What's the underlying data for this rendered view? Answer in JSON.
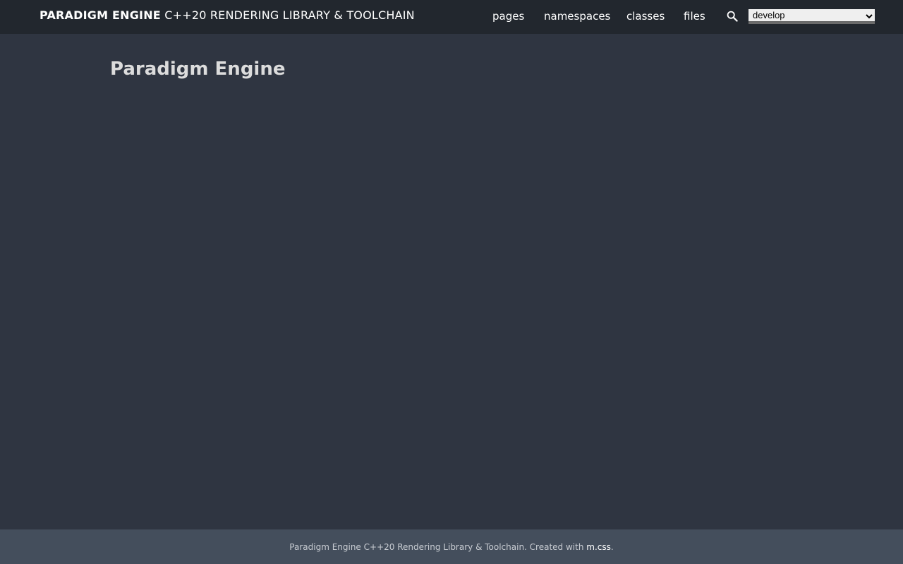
{
  "header": {
    "brand_name": "PARADIGM ENGINE",
    "brand_subtitle": "C++20 RENDERING LIBRARY & TOOLCHAIN",
    "nav": {
      "pages": "pages",
      "namespaces": "namespaces",
      "classes": "classes",
      "files": "files"
    },
    "search_icon": "search-icon",
    "version_select": {
      "selected": "develop",
      "options": [
        "develop"
      ]
    }
  },
  "main": {
    "title": "Paradigm Engine"
  },
  "footer": {
    "text": "Paradigm Engine C++20 Rendering Library & Toolchain. Created with ",
    "link_label": "m.css",
    "suffix": "."
  },
  "colors": {
    "background": "#2f3541",
    "topbar": "#22272e",
    "footer": "#444e5c",
    "title_text": "#dcdcdc",
    "nav_text": "#ffffff"
  }
}
